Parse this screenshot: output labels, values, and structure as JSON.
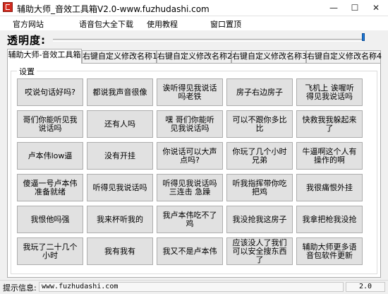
{
  "window": {
    "title": "辅助大师_音效工具箱V2.0-www.fuzhudashi.com",
    "minimize": "—",
    "maximize": "☐",
    "close": "✕"
  },
  "menu": {
    "items": [
      "官方网站",
      "语音包大全下载",
      "使用教程",
      "窗口置顶"
    ]
  },
  "opacity": {
    "label": "透明度:",
    "level_percent": 100
  },
  "tabs": [
    "辅助大师-音效工具箱",
    "右键自定义修改名称1",
    "右键自定义修改名称2",
    "右键自定义修改名称3",
    "右键自定义修改名称4"
  ],
  "settings_group": {
    "label": "设置"
  },
  "buttons": [
    "哎说句话好吗?",
    "都说我声音很像",
    "诶听得见我说话吗老铁",
    "房子右边房子",
    "飞机上 诶喔听得见我说话吗",
    "哥们你能听见我说话吗",
    "还有人吗",
    "嘿 哥们你能听见我说话吗",
    "可以不跟你多比比",
    "快救我我躲起来了",
    "卢本伟low逼",
    "没有开挂",
    "你说话可以大声点吗?",
    "你玩了几个小时兄弟",
    "牛逼啊这个人有操作的啊",
    "傻逼一号卢本伟准备就绪",
    "听得见我说话吗",
    "听得见我说话吗三连击 急躁",
    "听我指挥带你吃把鸡",
    "我很痛恨外挂",
    "我恨他吗强",
    "我来杯听我的",
    "我卢本伟吃不了鸡",
    "我没抢我这房子",
    "我拿把枪我没抢",
    "我玩了二十几个小时",
    "我有我有",
    "我又不是卢本伟",
    "应该没人了我们可以安全搜东西了",
    "辅助大师更多语音包软件更新"
  ],
  "status": {
    "label": "提示信息:",
    "message": "www.fuzhudashi.com",
    "version": "2.0"
  },
  "colors": {
    "accent": "#1e78d7",
    "app_icon": "#d22b1f"
  }
}
